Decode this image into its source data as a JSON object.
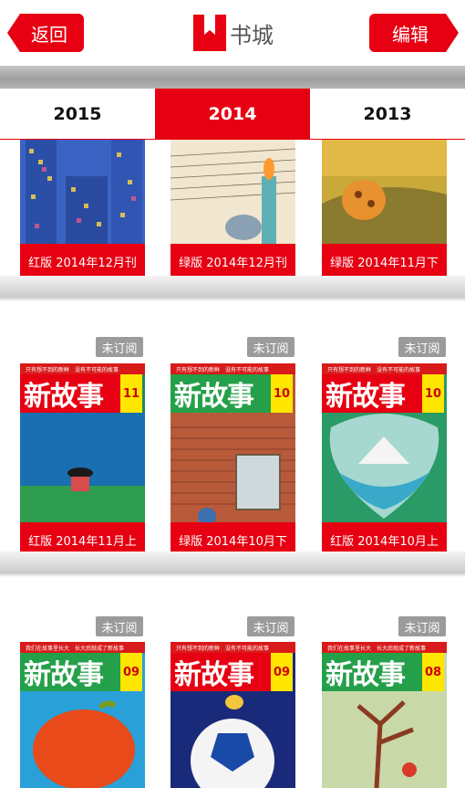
{
  "header": {
    "back_label": "返回",
    "title": "书城",
    "edit_label": "编辑"
  },
  "tabs": [
    {
      "label": "2015",
      "active": false
    },
    {
      "label": "2014",
      "active": true
    },
    {
      "label": "2013",
      "active": false
    }
  ],
  "badge_label": "未订阅",
  "masthead": {
    "title": "新故事",
    "strip_a": "只有想不到的新鲜　没有不可能的故事",
    "strip_b": "我们在故事里长大　长大后就成了新故事"
  },
  "shelf1": {
    "books": [
      {
        "label": "红版  2014年12月刊"
      },
      {
        "label": "绿版  2014年12月刊"
      },
      {
        "label": "绿版  2014年11月下"
      }
    ]
  },
  "shelf2": {
    "books": [
      {
        "label": "红版 2014年11月上",
        "issue": "11"
      },
      {
        "label": "绿版 2014年10月下",
        "issue": "10"
      },
      {
        "label": "红版 2014年10月上",
        "issue": "10"
      }
    ]
  },
  "shelf3": {
    "books": [
      {
        "issue": "09"
      },
      {
        "issue": "09"
      },
      {
        "issue": "08"
      }
    ]
  },
  "colors": {
    "accent": "#e60012",
    "badge": "#9b9b9b"
  }
}
